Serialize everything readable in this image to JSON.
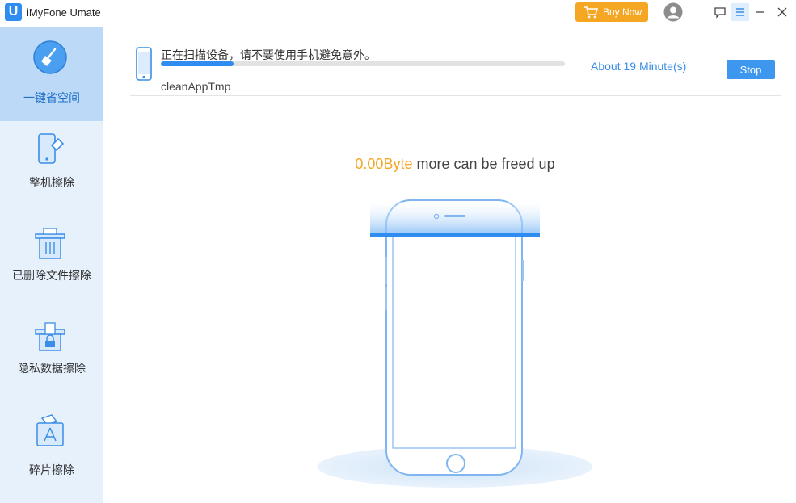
{
  "app": {
    "title": "iMyFone Umate",
    "logo_letter": "U"
  },
  "titlebar": {
    "buy_now_label": "Buy Now",
    "accent_color": "#f5a623"
  },
  "sidebar": {
    "items": [
      {
        "label": "一键省空间",
        "icon": "broom-icon",
        "active": true
      },
      {
        "label": "整机擦除",
        "icon": "phone-eraser-icon",
        "active": false
      },
      {
        "label": "已删除文件擦除",
        "icon": "trash-file-icon",
        "active": false
      },
      {
        "label": "隐私数据擦除",
        "icon": "lock-file-icon",
        "active": false
      },
      {
        "label": "碎片擦除",
        "icon": "app-fragment-icon",
        "active": false
      }
    ]
  },
  "scan": {
    "status_text": "正在扫描设备，请不要使用手机避免意外。",
    "current_item": "cleanAppTmp",
    "progress_fraction": 0.18,
    "time_remaining": "About 19 Minute(s)",
    "stop_label": "Stop"
  },
  "result": {
    "amount": "0.00Byte",
    "suffix": " more can be freed up"
  },
  "colors": {
    "primary": "#2f8cf0",
    "sidebar_bg": "#e6f1fc",
    "sidebar_active": "#bcdaf7"
  }
}
